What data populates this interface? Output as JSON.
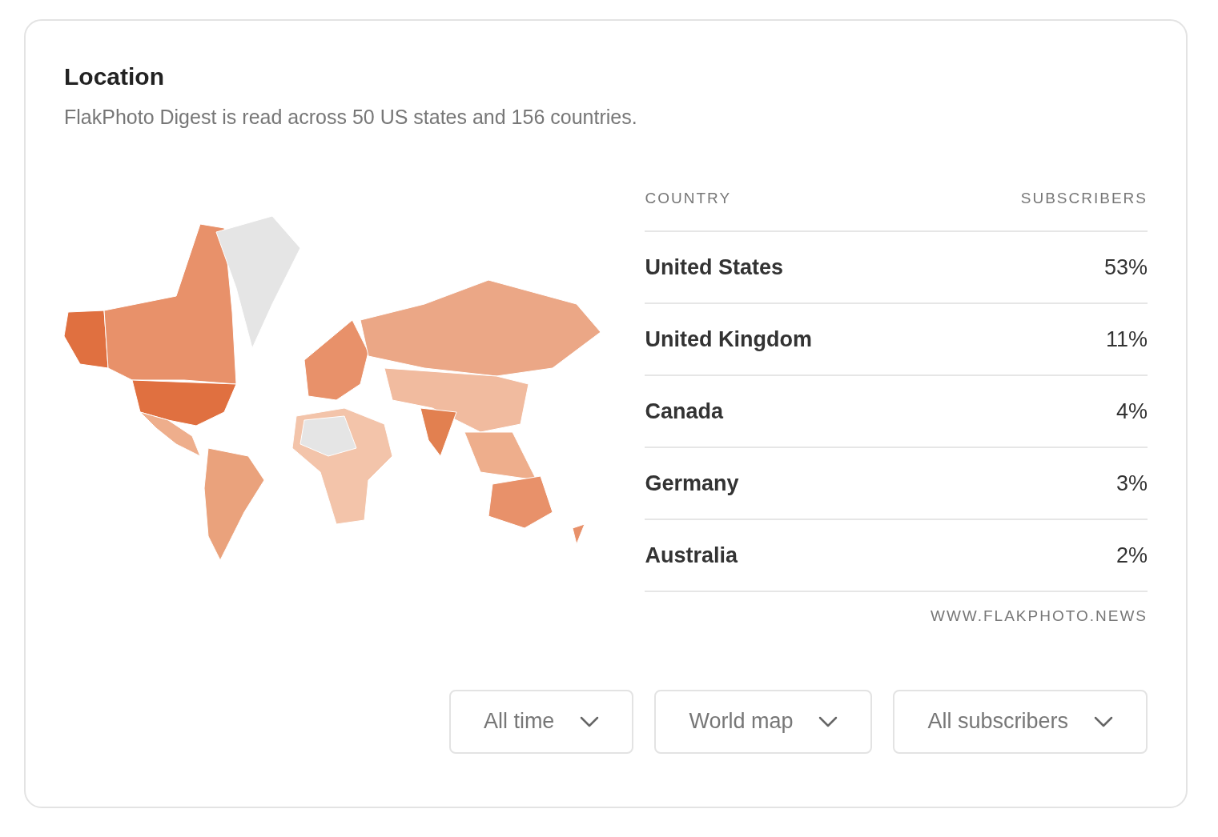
{
  "card": {
    "title": "Location",
    "subtitle": "FlakPhoto Digest is read across 50 US states and 156 countries."
  },
  "table": {
    "columns": [
      "COUNTRY",
      "SUBSCRIBERS"
    ],
    "rows": [
      {
        "country": "United States",
        "share": "53%"
      },
      {
        "country": "United Kingdom",
        "share": "11%"
      },
      {
        "country": "Canada",
        "share": "4%"
      },
      {
        "country": "Germany",
        "share": "3%"
      },
      {
        "country": "Australia",
        "share": "2%"
      }
    ]
  },
  "source": "WWW.FLAKPHOTO.NEWS",
  "filters": [
    {
      "label": "All time"
    },
    {
      "label": "World map"
    },
    {
      "label": "All subscribers"
    }
  ]
}
